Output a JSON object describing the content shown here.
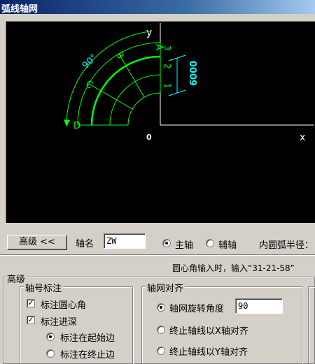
{
  "window": {
    "title": "弧线轴网"
  },
  "preview": {
    "y_axis_label": "y",
    "x_axis_label": "x",
    "origin_label": "0",
    "angle_label": "90°",
    "axis_labels": [
      "A",
      "B",
      "C",
      "D"
    ],
    "radial_labels": [
      "1",
      "2",
      "3"
    ],
    "dimension_label": "6000",
    "colors": {
      "grid": "#00ff00",
      "axes": "#ffffff",
      "dim": "#00ffff"
    }
  },
  "toolbar": {
    "advanced_button": "高级 <<",
    "axis_name_label": "轴名",
    "axis_name_value": "ZW",
    "main_axis": "主轴",
    "aux_axis": "辅轴",
    "inner_radius_label": "内圆弧半径："
  },
  "hint": "圆心角输入时，输入“31-21-58”",
  "advanced": {
    "title": "高级",
    "numbering_group": {
      "title": "轴号标注",
      "center_angle": "标注圆心角",
      "depth": "标注进深",
      "at_start": "标注在起始边",
      "at_end": "标注在终止边"
    },
    "align_group": {
      "title": "轴网对齐",
      "rotation_label": "轴网旋转角度",
      "rotation_value": "90",
      "align_x": "终止轴线以X轴对齐",
      "align_y": "终止轴线以Y轴对齐"
    }
  }
}
